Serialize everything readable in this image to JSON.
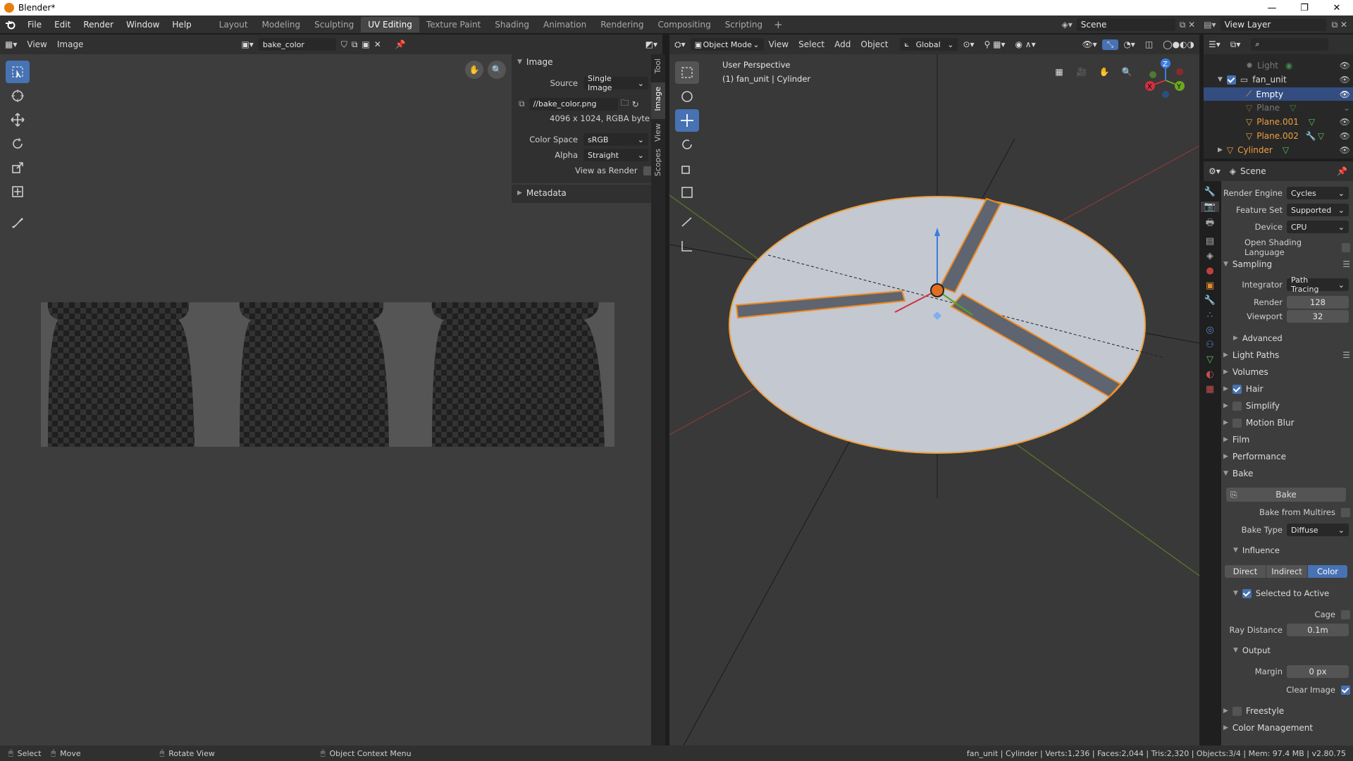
{
  "window": {
    "title": "Blender*",
    "controls": [
      "—",
      "❐",
      "✕"
    ]
  },
  "menu": [
    "File",
    "Edit",
    "Render",
    "Window",
    "Help"
  ],
  "workspaces": [
    "Layout",
    "Modeling",
    "Sculpting",
    "UV Editing",
    "Texture Paint",
    "Shading",
    "Animation",
    "Rendering",
    "Compositing",
    "Scripting"
  ],
  "active_workspace": "UV Editing",
  "scene_name": "Scene",
  "view_layer": "View Layer",
  "image_editor": {
    "menus": [
      "View",
      "Image"
    ],
    "image_name": "bake_color",
    "sidebar_tabs": [
      "Tool",
      "Image",
      "View",
      "Scopes"
    ],
    "panel_title": "Image",
    "source_label": "Source",
    "source_value": "Single Image",
    "filepath": "//bake_color.png",
    "info": "4096 x 1024,  RGBA byte",
    "color_space_label": "Color Space",
    "color_space_value": "sRGB",
    "alpha_label": "Alpha",
    "alpha_value": "Straight",
    "view_as_render": "View as Render",
    "metadata": "Metadata"
  },
  "viewport": {
    "mode": "Object Mode",
    "menus": [
      "View",
      "Select",
      "Add",
      "Object"
    ],
    "orientation": "Global",
    "perspective": "User Perspective",
    "object_info": "(1) fan_unit | Cylinder",
    "gizmo_axes": [
      "X",
      "Y",
      "Z"
    ]
  },
  "outliner": {
    "items": [
      {
        "name": "Light",
        "dim": true
      },
      {
        "name": "fan_unit",
        "dim": false
      },
      {
        "name": "Empty",
        "dim": false,
        "selected": true
      },
      {
        "name": "Plane",
        "dim": true
      },
      {
        "name": "Plane.001",
        "dim": false,
        "orange": true
      },
      {
        "name": "Plane.002",
        "dim": false,
        "orange": true
      },
      {
        "name": "Cylinder",
        "dim": false,
        "orange": true
      }
    ]
  },
  "properties": {
    "context": "Scene",
    "render_engine_label": "Render Engine",
    "render_engine": "Cycles",
    "feature_set_label": "Feature Set",
    "feature_set": "Supported",
    "device_label": "Device",
    "device": "CPU",
    "osl": "Open Shading Language",
    "sampling": "Sampling",
    "integrator_label": "Integrator",
    "integrator": "Path Tracing",
    "render_label": "Render",
    "render_samples": "128",
    "viewport_label": "Viewport",
    "viewport_samples": "32",
    "advanced": "Advanced",
    "collapsed_sections": [
      "Light Paths",
      "Volumes",
      "Hair",
      "Simplify",
      "Motion Blur",
      "Film",
      "Performance"
    ],
    "bake": "Bake",
    "bake_button": "Bake",
    "bake_from_multires": "Bake from Multires",
    "bake_type_label": "Bake Type",
    "bake_type": "Diffuse",
    "influence": "Influence",
    "influence_buttons": [
      "Direct",
      "Indirect",
      "Color"
    ],
    "selected_to_active": "Selected to Active",
    "cage": "Cage",
    "ray_distance_label": "Ray Distance",
    "ray_distance": "0.1m",
    "output": "Output",
    "margin_label": "Margin",
    "margin": "0 px",
    "clear_image": "Clear Image",
    "freestyle": "Freestyle",
    "color_management": "Color Management"
  },
  "status": {
    "select": "Select",
    "move": "Move",
    "rotate": "Rotate View",
    "context": "Object Context Menu",
    "stats": "fan_unit | Cylinder | Verts:1,236 | Faces:2,044 | Tris:2,320 | Objects:3/4 | Mem: 97.4 MB | v2.80.75"
  }
}
